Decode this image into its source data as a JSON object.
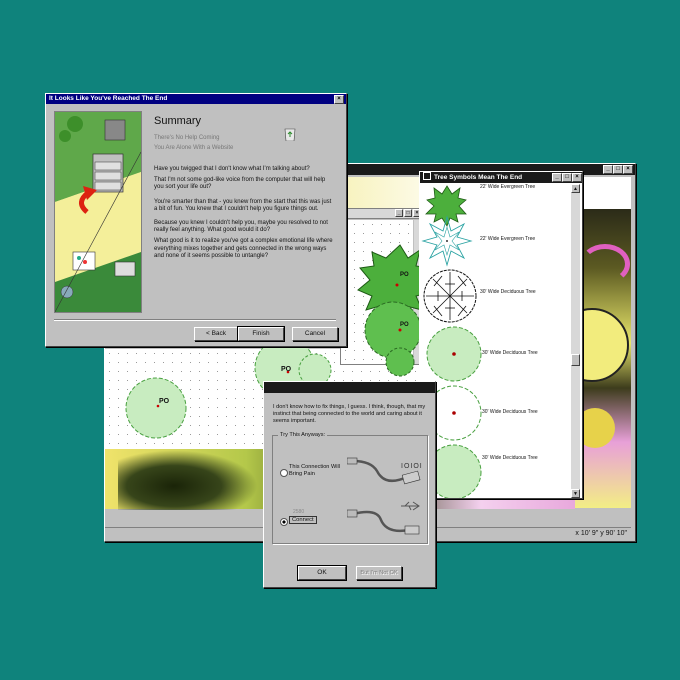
{
  "colors": {
    "desktop": "#0f837c",
    "title_bar": "#000080",
    "window": "#c0c0c0"
  },
  "summary_window": {
    "title": "It Looks Like You've Reached The End",
    "heading": "Summary",
    "subline1": "There's No Help Coming",
    "subline2": "You Are Alone With a Website",
    "paragraphs": [
      "Have you twigged that I don't know what I'm talking about?",
      "That I'm not some god-like voice from the computer that will help you sort your life out?",
      "You're smarter than that - you knew from the start that this was just a bit of fun. You knew that I couldn't help you figure things out.",
      "Because you knew I couldn't help you, maybe you resolved to not really feel anything. What good would it do?",
      "What good is it to realize you've got a complex emotional life where everything mixes together and gets connected in the wrong ways and none of it seems possible to untangle?"
    ],
    "buttons": {
      "back": "< Back",
      "finish": "Finish",
      "cancel": "Cancel"
    },
    "icon": "recycle-bin-icon"
  },
  "tree_window": {
    "title": "Tree Symbols Mean The End",
    "items": [
      "22' Wide Evergreen Tree",
      "22' Wide Evergreen Tree",
      "30' Wide Deciduous Tree",
      "30' Wide Deciduous Tree",
      "30' Wide Deciduous Tree",
      "30' Wide Deciduous Tree"
    ]
  },
  "plan_window": {
    "status": "x 10' 9\" y 90' 10\"",
    "labels": [
      "PO",
      "PO",
      "PO",
      "PO"
    ]
  },
  "connect_dialog": {
    "message": "I don't know how to fix things, I guess. I think, though, that my instinct that being connected to the world and caring about it seems important.",
    "group_label": "Try This Anyways:",
    "option1": "This Connection Will Bring Pain",
    "option1_icon_text": "IOIOI",
    "option2_small": "2580",
    "option2": "Connect",
    "buttons": {
      "ok": "OK",
      "not_ok": "But I'm Not OK"
    }
  }
}
